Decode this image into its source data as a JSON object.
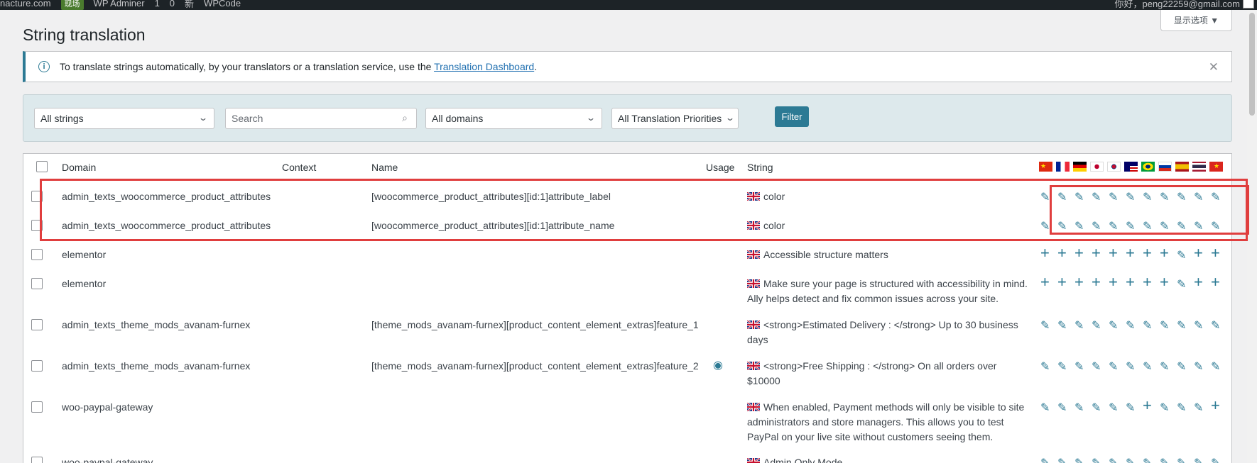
{
  "admin_bar": {
    "site": "nacture.com",
    "badge": "现场",
    "items": [
      "WP Adminer",
      "1",
      "0",
      "新",
      "WPCode"
    ],
    "greeting": "你好，peng22259@gmail.com"
  },
  "screen_options": "显示选项 ▼",
  "page_title": "String translation",
  "notice": {
    "text": "To translate strings automatically, by your translators or a translation service, use the ",
    "link": "Translation Dashboard",
    "after": "."
  },
  "filters": {
    "strings_select": "All strings",
    "search_placeholder": "Search",
    "domains_select": "All domains",
    "priorities_select": "All Translation Priorities",
    "filter_button": "Filter"
  },
  "table": {
    "headers": {
      "domain": "Domain",
      "context": "Context",
      "name": "Name",
      "usage": "Usage",
      "string": "String"
    },
    "languages": [
      "zh",
      "fr",
      "de",
      "ja",
      "ko",
      "ms",
      "pt-br",
      "ru",
      "es",
      "th",
      "vi"
    ],
    "rows": [
      {
        "domain": "admin_texts_woocommerce_product_attributes",
        "name": "[woocommerce_product_attributes][id:1]attribute_label",
        "string": "color",
        "usage": false,
        "actions": [
          "edit",
          "edit",
          "edit",
          "edit",
          "edit",
          "edit",
          "edit",
          "edit",
          "edit",
          "edit",
          "edit"
        ]
      },
      {
        "domain": "admin_texts_woocommerce_product_attributes",
        "name": "[woocommerce_product_attributes][id:1]attribute_name",
        "string": "color",
        "usage": false,
        "actions": [
          "edit",
          "edit",
          "edit",
          "edit",
          "edit",
          "edit",
          "edit",
          "edit",
          "edit",
          "edit",
          "edit"
        ]
      },
      {
        "domain": "elementor",
        "name": "",
        "string": "Accessible structure matters",
        "usage": false,
        "actions": [
          "add",
          "add",
          "add",
          "add",
          "add",
          "add",
          "add",
          "add",
          "edit",
          "add",
          "add"
        ]
      },
      {
        "domain": "elementor",
        "name": "",
        "string": "Make sure your page is structured with accessibility in mind. Ally helps detect and fix common issues across your site.",
        "usage": false,
        "actions": [
          "add",
          "add",
          "add",
          "add",
          "add",
          "add",
          "add",
          "add",
          "edit",
          "add",
          "add"
        ]
      },
      {
        "domain": "admin_texts_theme_mods_avanam-furnex",
        "name": "[theme_mods_avanam-furnex][product_content_element_extras]feature_1",
        "string": "<strong>Estimated Delivery : </strong> Up to 30 business days",
        "usage": false,
        "actions": [
          "edit",
          "edit",
          "edit",
          "edit",
          "edit",
          "edit",
          "edit",
          "edit",
          "edit",
          "edit",
          "edit"
        ]
      },
      {
        "domain": "admin_texts_theme_mods_avanam-furnex",
        "name": "[theme_mods_avanam-furnex][product_content_element_extras]feature_2",
        "string": "<strong>Free Shipping : </strong> On all orders over $10000",
        "usage": true,
        "actions": [
          "edit",
          "edit",
          "edit",
          "edit",
          "edit",
          "edit",
          "edit",
          "edit",
          "edit",
          "edit",
          "edit"
        ]
      },
      {
        "domain": "woo-paypal-gateway",
        "name": "",
        "string": "When enabled, Payment methods will only be visible to site administrators and store managers. This allows you to test PayPal on your live site without customers seeing them.",
        "usage": false,
        "actions": [
          "edit",
          "edit",
          "edit",
          "edit",
          "edit",
          "edit",
          "add",
          "edit",
          "edit",
          "edit",
          "add"
        ]
      },
      {
        "domain": "woo-paypal-gateway",
        "name": "",
        "string": "Admin Only Mode",
        "usage": false,
        "actions": [
          "edit",
          "edit",
          "edit",
          "edit",
          "edit",
          "edit",
          "edit",
          "edit",
          "edit",
          "edit",
          "edit"
        ]
      }
    ]
  },
  "colors": {
    "accent": "#2c7a94",
    "highlight": "#e03e3e",
    "filter_bg": "#dde9ec"
  }
}
